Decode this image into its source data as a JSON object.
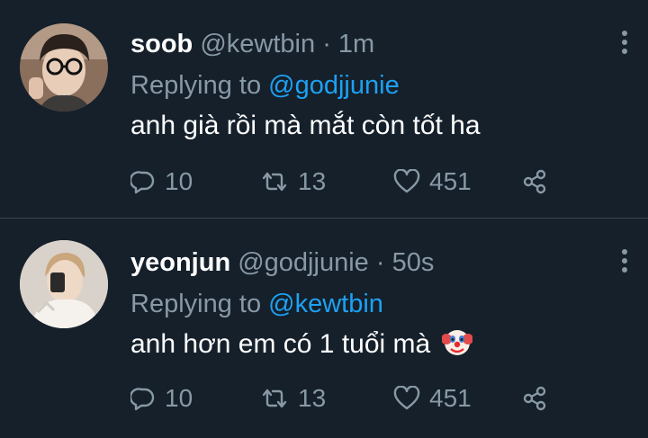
{
  "tweets": [
    {
      "display_name": "soob",
      "handle": "@kewtbin",
      "separator": "·",
      "time": "1m",
      "replying_prefix": "Replying to",
      "replying_handle": "@godjjunie",
      "text": "anh già rồi mà mắt còn tốt ha",
      "emoji": "",
      "replies": "10",
      "retweets": "13",
      "likes": "451",
      "icons": {
        "reply": "reply-icon",
        "retweet": "retweet-icon",
        "like": "heart-icon",
        "share": "share-icon",
        "more": "more-icon"
      }
    },
    {
      "display_name": "yeonjun",
      "handle": "@godjjunie",
      "separator": "·",
      "time": "50s",
      "replying_prefix": "Replying to",
      "replying_handle": "@kewtbin",
      "text": "anh hơn em có 1 tuổi mà",
      "emoji": "clown-face-emoji",
      "replies": "10",
      "retweets": "13",
      "likes": "451",
      "icons": {
        "reply": "reply-icon",
        "retweet": "retweet-icon",
        "like": "heart-icon",
        "share": "share-icon",
        "more": "more-icon"
      }
    }
  ],
  "colors": {
    "background": "#15202b",
    "text": "#ffffff",
    "secondary": "#8899a6",
    "link": "#1da1f2",
    "divider": "#38444d"
  }
}
